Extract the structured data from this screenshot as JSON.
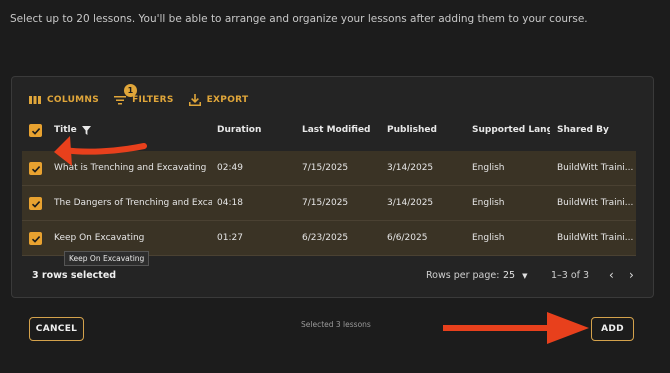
{
  "instructions": "Select up to 20 lessons. You'll be able to arrange and organize your lessons after adding them to your course.",
  "toolbar": {
    "columns_label": "COLUMNS",
    "filters_label": "FILTERS",
    "filters_badge": "1",
    "export_label": "EXPORT"
  },
  "table": {
    "headers": [
      "Title",
      "Duration",
      "Last Modified",
      "Published",
      "Supported Langu...",
      "Shared By"
    ],
    "rows": [
      {
        "title": "What is Trenching and Excavating",
        "duration": "02:49",
        "last_modified": "7/15/2025",
        "published": "3/14/2025",
        "language": "English",
        "shared_by": "BuildWitt Traini..."
      },
      {
        "title": "The Dangers of Trenching and Exca...",
        "duration": "04:18",
        "last_modified": "7/15/2025",
        "published": "3/14/2025",
        "language": "English",
        "shared_by": "BuildWitt Traini..."
      },
      {
        "title": "Keep On Excavating",
        "duration": "01:27",
        "last_modified": "6/23/2025",
        "published": "6/6/2025",
        "language": "English",
        "shared_by": "BuildWitt Traini..."
      }
    ]
  },
  "tooltip": "Keep On Excavating",
  "footer": {
    "selected_count": "3 rows selected",
    "rows_per_page_label": "Rows per page:",
    "rows_per_page_value": "25",
    "range": "1–3 of 3"
  },
  "actions": {
    "cancel_label": "CANCEL",
    "selected_note": "Selected 3 lessons",
    "add_label": "ADD"
  },
  "colors": {
    "accent": "#e0a63a",
    "annotation_arrow": "#e8401c"
  }
}
